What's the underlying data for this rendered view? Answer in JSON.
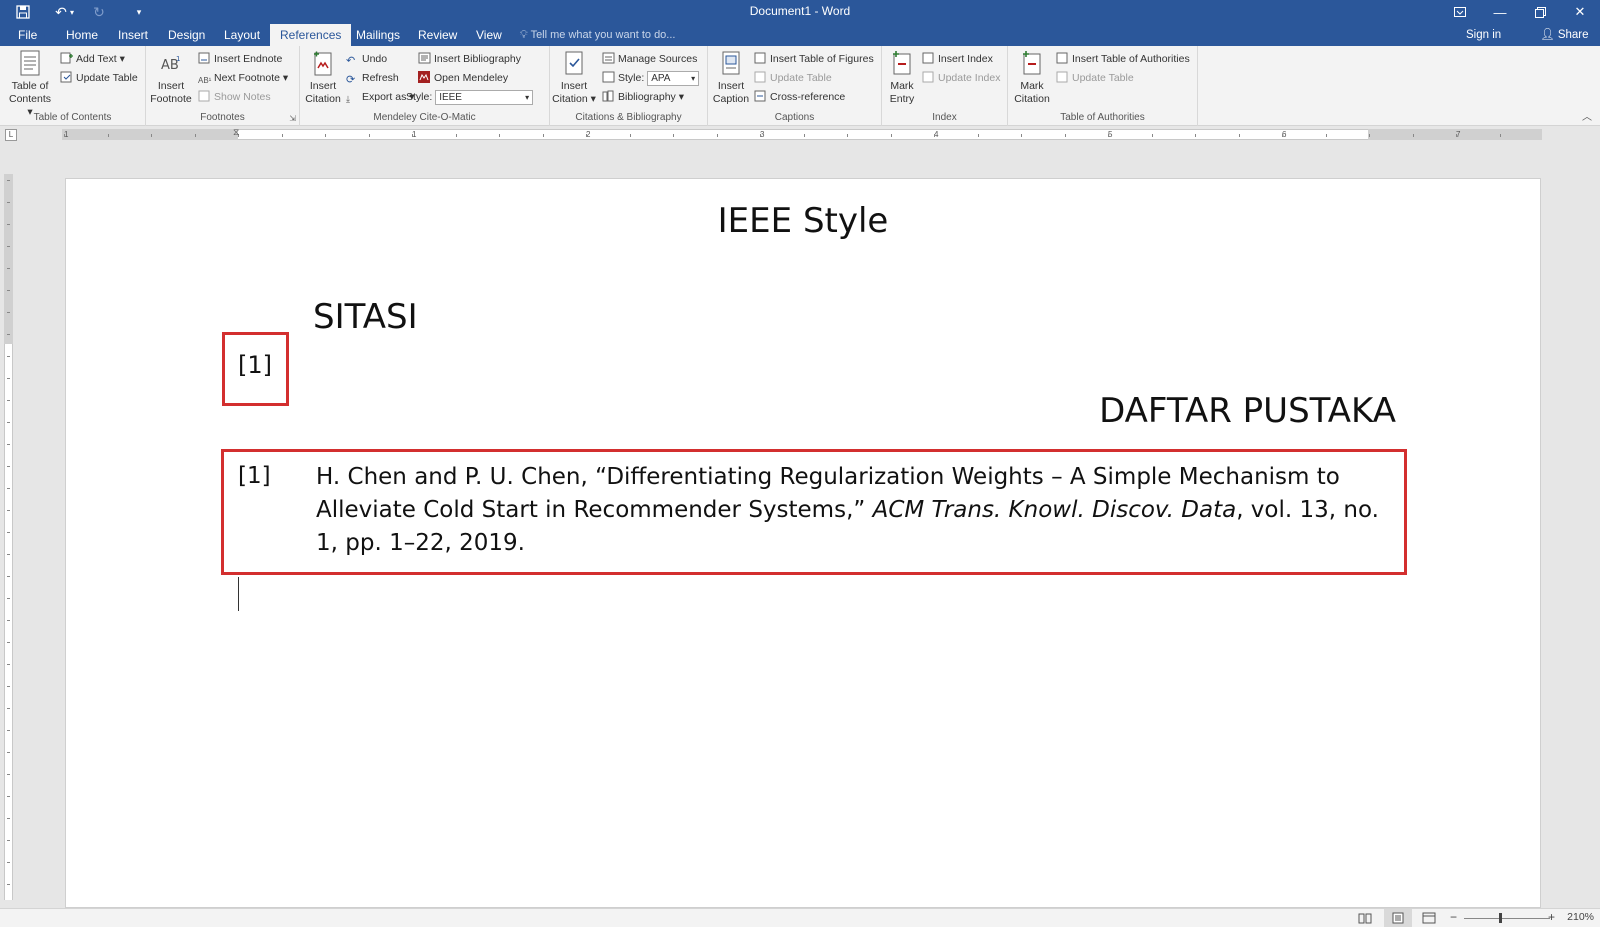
{
  "app": {
    "title": "Document1 - Word"
  },
  "tabs": [
    {
      "label": "File"
    },
    {
      "label": "Home"
    },
    {
      "label": "Insert"
    },
    {
      "label": "Design"
    },
    {
      "label": "Layout"
    },
    {
      "label": "References"
    },
    {
      "label": "Mailings"
    },
    {
      "label": "Review"
    },
    {
      "label": "View"
    }
  ],
  "tell_me": "Tell me what you want to do...",
  "sign_in": "Sign in",
  "share": "Share",
  "ribbon": {
    "toc": {
      "table_of_contents": [
        "Table of",
        "Contents"
      ],
      "add_text": "Add Text",
      "update_table": "Update Table",
      "label": "Table of Contents"
    },
    "footnotes": {
      "insert_footnote": [
        "Insert",
        "Footnote"
      ],
      "insert_endnote": "Insert Endnote",
      "next_footnote": "Next Footnote",
      "show_notes": "Show Notes",
      "label": "Footnotes"
    },
    "mendeley": {
      "insert_citation": [
        "Insert",
        "Citation"
      ],
      "undo": "Undo",
      "refresh": "Refresh",
      "export_as": "Export as",
      "insert_bibliography": "Insert Bibliography",
      "open_mendeley": "Open Mendeley",
      "style_label": "Style:",
      "style_value": "IEEE",
      "label": "Mendeley Cite-O-Matic"
    },
    "citations": {
      "insert_citation": [
        "Insert",
        "Citation"
      ],
      "manage_sources": "Manage Sources",
      "style_label": "Style:",
      "style_value": "APA",
      "bibliography": "Bibliography",
      "label": "Citations & Bibliography"
    },
    "captions": {
      "insert_caption": [
        "Insert",
        "Caption"
      ],
      "insert_table_of_figures": "Insert Table of Figures",
      "update_table": "Update Table",
      "cross_reference": "Cross-reference",
      "label": "Captions"
    },
    "index": {
      "mark_entry": [
        "Mark",
        "Entry"
      ],
      "insert_index": "Insert Index",
      "update_index": "Update Index",
      "label": "Index"
    },
    "toa": {
      "mark_citation": [
        "Mark",
        "Citation"
      ],
      "insert_toa": "Insert Table of Authorities",
      "update_table": "Update Table",
      "label": "Table of Authorities"
    }
  },
  "ruler_numbers": [
    "1",
    "1",
    "2",
    "3",
    "4",
    "5",
    "6",
    "7"
  ],
  "document": {
    "title": "IEEE Style",
    "sitasi": "SITASI",
    "citation": "[1]",
    "daftar": "DAFTAR PUSTAKA",
    "bib_number": "[1]",
    "bib_part1": "H. Chen and P. U. Chen, “Differentiating Regularization Weights – A Simple Mechanism to Alleviate Cold Start in Recommender Systems,” ",
    "bib_journal": "ACM Trans. Knowl. Discov. Data",
    "bib_part2": ", vol. 13, no. 1, pp. 1–22, 2019."
  },
  "status": {
    "zoom": "210%"
  },
  "colors": {
    "word_blue": "#2b579a",
    "highlight_red": "#d32f2f"
  }
}
